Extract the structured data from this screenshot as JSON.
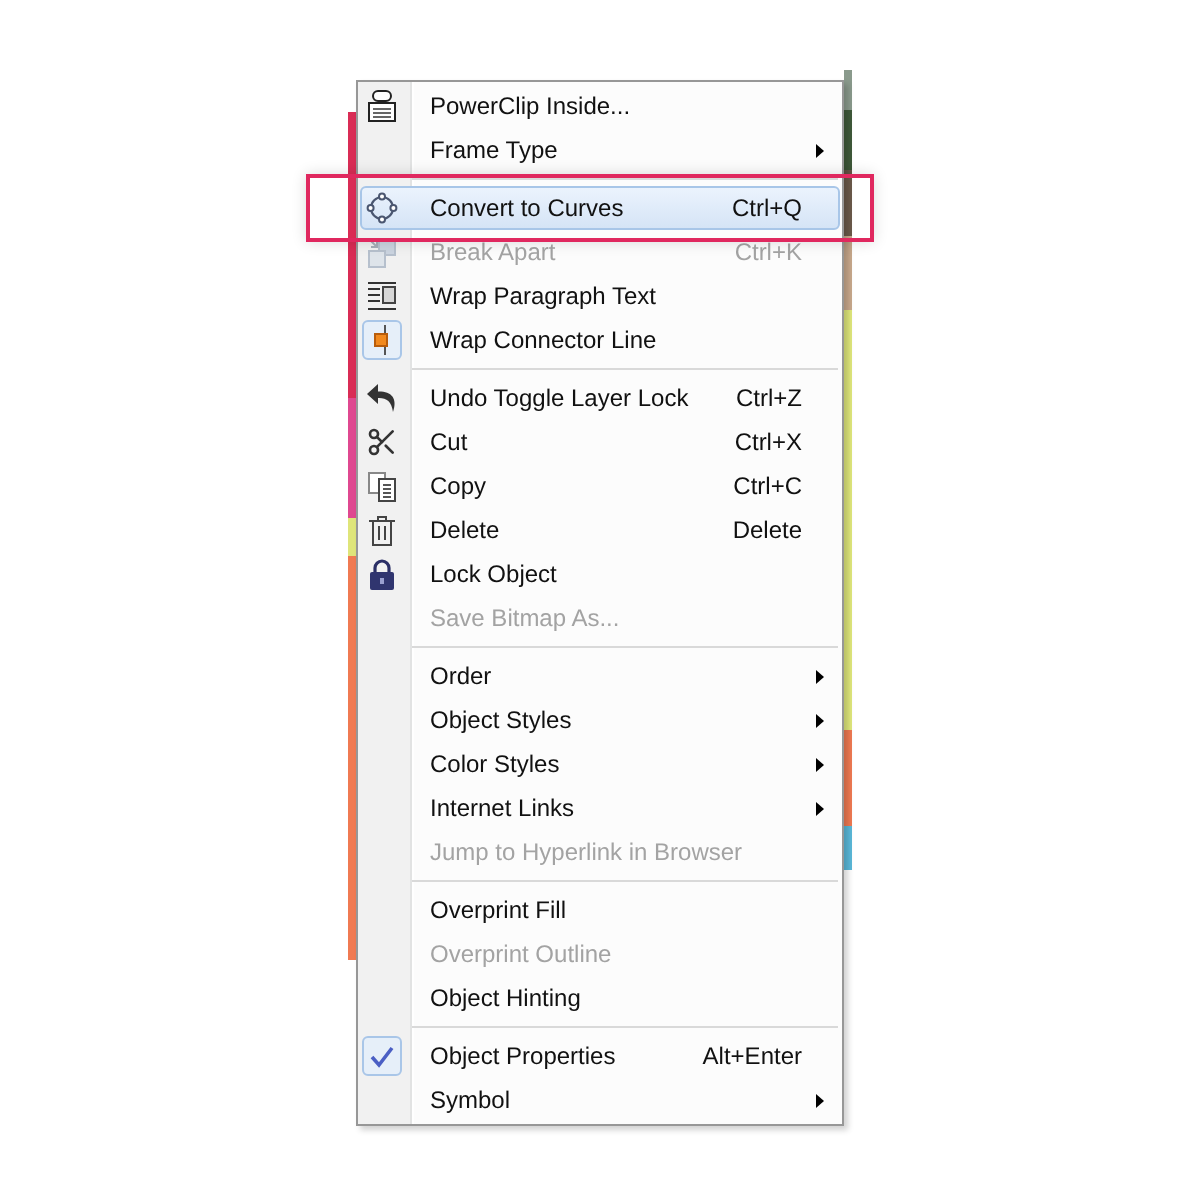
{
  "menu": {
    "sections": [
      {
        "items": [
          {
            "label": "PowerClip Inside...",
            "selected": false,
            "framed": false,
            "disabled": false,
            "checked": false,
            "submenu": false
          },
          {
            "label": "Frame Type",
            "selected": false,
            "framed": false,
            "disabled": false,
            "checked": false,
            "submenu": true
          }
        ]
      },
      {
        "items": [
          {
            "label": "Convert to Curves",
            "shortcut": "Ctrl+Q",
            "selected": true,
            "framed": true,
            "disabled": false,
            "checked": false,
            "submenu": false
          },
          {
            "label": "Break Apart",
            "shortcut": "Ctrl+K",
            "selected": false,
            "framed": false,
            "disabled": true,
            "checked": false,
            "submenu": false
          },
          {
            "label": "Wrap Paragraph Text",
            "selected": false,
            "framed": false,
            "disabled": false,
            "checked": false,
            "submenu": false
          },
          {
            "label": "Wrap Connector Line",
            "selected": false,
            "framed": false,
            "disabled": false,
            "checked": true,
            "submenu": false
          }
        ]
      },
      {
        "items": [
          {
            "label": "Undo Toggle Layer Lock",
            "shortcut": "Ctrl+Z",
            "selected": false,
            "framed": false,
            "disabled": false,
            "checked": false,
            "submenu": false
          },
          {
            "label": "Cut",
            "shortcut": "Ctrl+X",
            "selected": false,
            "framed": false,
            "disabled": false,
            "checked": false,
            "submenu": false
          },
          {
            "label": "Copy",
            "shortcut": "Ctrl+C",
            "selected": false,
            "framed": false,
            "disabled": false,
            "checked": false,
            "submenu": false
          },
          {
            "label": "Delete",
            "shortcut": "Delete",
            "selected": false,
            "framed": false,
            "disabled": false,
            "checked": false,
            "submenu": false
          },
          {
            "label": "Lock Object",
            "selected": false,
            "framed": false,
            "disabled": false,
            "checked": false,
            "submenu": false
          },
          {
            "label": "Save Bitmap As...",
            "selected": false,
            "framed": false,
            "disabled": true,
            "checked": false,
            "submenu": false
          }
        ]
      },
      {
        "items": [
          {
            "label": "Order",
            "selected": false,
            "framed": false,
            "disabled": false,
            "checked": false,
            "submenu": true
          },
          {
            "label": "Object Styles",
            "selected": false,
            "framed": false,
            "disabled": false,
            "checked": false,
            "submenu": true
          },
          {
            "label": "Color Styles",
            "selected": false,
            "framed": false,
            "disabled": false,
            "checked": false,
            "submenu": true
          },
          {
            "label": "Internet Links",
            "selected": false,
            "framed": false,
            "disabled": false,
            "checked": false,
            "submenu": true
          },
          {
            "label": "Jump to Hyperlink in Browser",
            "selected": false,
            "framed": false,
            "disabled": true,
            "checked": false,
            "submenu": false
          }
        ]
      },
      {
        "items": [
          {
            "label": "Overprint Fill",
            "selected": false,
            "framed": false,
            "disabled": false,
            "checked": false,
            "submenu": false
          },
          {
            "label": "Overprint Outline",
            "selected": false,
            "framed": false,
            "disabled": true,
            "checked": false,
            "submenu": false
          },
          {
            "label": "Object Hinting",
            "selected": false,
            "framed": false,
            "disabled": false,
            "checked": false,
            "submenu": false
          }
        ]
      },
      {
        "items": [
          {
            "label": "Object Properties",
            "shortcut": "Alt+Enter",
            "selected": false,
            "framed": false,
            "disabled": false,
            "checked": true,
            "submenu": false
          },
          {
            "label": "Symbol",
            "selected": false,
            "framed": false,
            "disabled": false,
            "checked": false,
            "submenu": true
          }
        ]
      }
    ]
  }
}
